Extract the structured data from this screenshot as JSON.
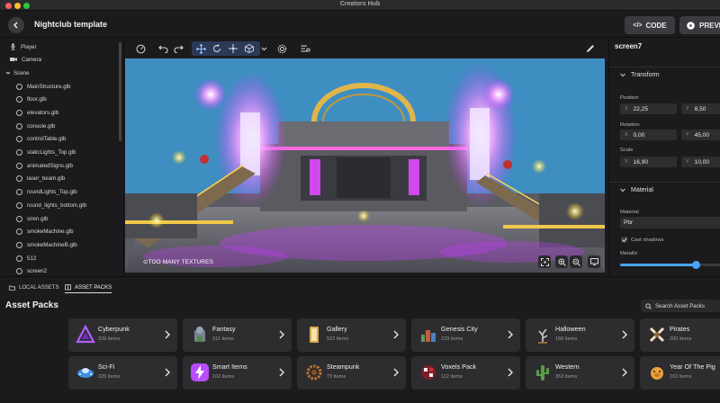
{
  "window": {
    "title": "Creators Hub"
  },
  "header": {
    "title": "Nightclub template",
    "code_label": "CODE",
    "preview_label": "PREVIEW"
  },
  "left_panel": {
    "top_items": [
      {
        "label": "Player",
        "icon": "person-icon"
      },
      {
        "label": "Camera",
        "icon": "camera-icon"
      }
    ],
    "scene_label": "Scene",
    "scene_items": [
      "MainStructure.glb",
      "floor.glb",
      "elevators.glb",
      "console.glb",
      "controlTable.glb",
      "staticLights_Top.glb",
      "animatedSigns.glb",
      "laser_beam.glb",
      "roundLights_Top.glb",
      "round_lights_bottom.glb",
      "siren.glb",
      "smokeMachine.glb",
      "smokeMachineB.glb",
      "512",
      "screen2"
    ]
  },
  "viewport": {
    "watermark": "TOO MANY TEXTURES"
  },
  "inspector": {
    "entity_name": "screen7",
    "transform": {
      "title": "Transform",
      "position_label": "Position",
      "position": {
        "x": "22,25",
        "y": "8,50"
      },
      "rotation_label": "Rotation",
      "rotation": {
        "x": "0,00",
        "y": "45,00"
      },
      "scale_label": "Scale",
      "scale": {
        "x": "16,90",
        "y": "10,00"
      }
    },
    "material": {
      "title": "Material",
      "field_label": "Material",
      "value": "Pbr",
      "cast_shadows_label": "Cast shadows",
      "cast_shadows": true,
      "metallic_label": "Metallic",
      "metallic_value": 0.75
    }
  },
  "bottom": {
    "tabs": [
      {
        "label": "LOCAL ASSETS",
        "active": false
      },
      {
        "label": "ASSET PACKS",
        "active": true
      }
    ],
    "section_title": "Asset Packs",
    "search_label": "Search Asset Packs",
    "packs": [
      {
        "name": "Cyberpunk",
        "count": "339 items",
        "icon": "cyberpunk-icon"
      },
      {
        "name": "Fantasy",
        "count": "311 items",
        "icon": "fantasy-icon"
      },
      {
        "name": "Gallery",
        "count": "522 items",
        "icon": "gallery-icon"
      },
      {
        "name": "Genesis City",
        "count": "229 items",
        "icon": "genesis-city-icon"
      },
      {
        "name": "Halloween",
        "count": "156 items",
        "icon": "halloween-icon"
      },
      {
        "name": "Pirates",
        "count": "200 items",
        "icon": "pirates-icon"
      },
      {
        "name": "Sci-Fi",
        "count": "225 items",
        "icon": "scifi-icon"
      },
      {
        "name": "Smart Items",
        "count": "102 items",
        "icon": "smart-items-icon"
      },
      {
        "name": "Steampunk",
        "count": "73 items",
        "icon": "steampunk-icon"
      },
      {
        "name": "Voxels Pack",
        "count": "112 items",
        "icon": "voxels-icon"
      },
      {
        "name": "Western",
        "count": "353 items",
        "icon": "western-icon"
      },
      {
        "name": "Year Of The Pig",
        "count": "162 items",
        "icon": "pig-icon"
      }
    ]
  },
  "colors": {
    "accent": "#4aa3ff",
    "sky": "#3f8ec2",
    "neon": "#d64dff"
  }
}
